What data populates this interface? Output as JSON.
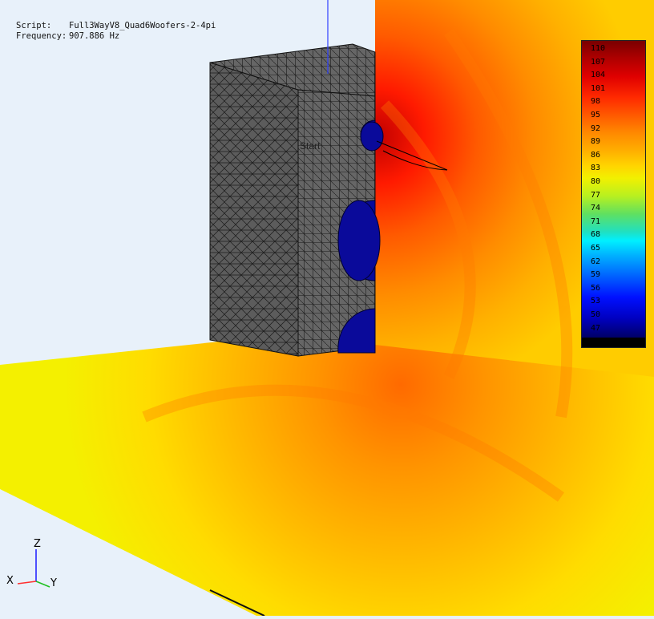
{
  "info": {
    "script_label": "Script:",
    "script_value": "Full3WayV8_Quad6Woofers-2-4pi",
    "frequency_label": "Frequency:",
    "frequency_value": "907.886 Hz"
  },
  "scene": {
    "source_label": "Start",
    "axes": {
      "z": "Z",
      "x": "X",
      "y": "Y"
    }
  },
  "colorbar": {
    "ticks": [
      "110",
      "107",
      "104",
      "101",
      "98",
      "95",
      "92",
      "89",
      "86",
      "83",
      "80",
      "77",
      "74",
      "71",
      "68",
      "65",
      "62",
      "59",
      "56",
      "53",
      "50",
      "47"
    ]
  },
  "colors": {
    "background": "#e8f1fa",
    "mesh": "#5a5a5a",
    "driver": "#0a0a9a"
  }
}
